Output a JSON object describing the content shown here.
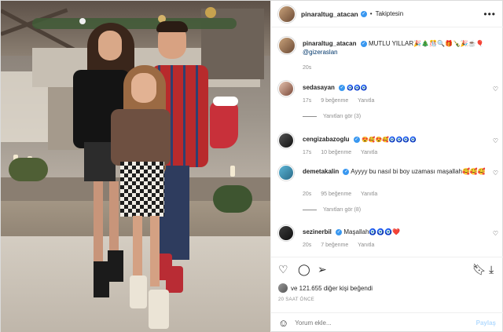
{
  "header": {
    "username": "pinaraltug_atacan",
    "follow_status": "Takiptesin",
    "more_icon": "more-horizontal-icon"
  },
  "caption": {
    "username": "pinaraltug_atacan",
    "text": "MUTLU YILLAR🎉🎄🎊🔍🎁🍾🎉☕🎈",
    "mention": "@gizeraslan",
    "time": "20s"
  },
  "comments": [
    {
      "username": "sedasayan",
      "text": "🧿🧿🧿",
      "time": "17s",
      "likes": "9 beğenme",
      "reply": "Yanıtla",
      "view_replies": "Yanıtları gör (3)"
    },
    {
      "username": "cengizabazoglu",
      "text": "😍🥰😍🥰🧿🧿🧿🧿",
      "time": "17s",
      "likes": "10 beğenme",
      "reply": "Yanıtla"
    },
    {
      "username": "demetakalin",
      "text": "Ayyyy bu nasıl bi boy uzaması maşallah🥰🥰🥰",
      "time": "20s",
      "likes": "95 beğenme",
      "reply": "Yanıtla",
      "view_replies": "Yanıtları gör (8)"
    },
    {
      "username": "sezinerbil",
      "text": "Maşallah🧿🧿🧿❤️",
      "time": "20s",
      "likes": "7 beğenme",
      "reply": "Yanıtla"
    }
  ],
  "likes": {
    "text": "ve 121.655 diğer kişi beğendi"
  },
  "time_ago": "20 SAAT ÖNCE",
  "comment_box": {
    "placeholder": "Yorum ekle...",
    "post_label": "Paylaş"
  },
  "colors": {
    "verified": "#3897f0",
    "mention": "#00376b",
    "muted": "#8e8e8e",
    "post_button": "#b3dbff"
  }
}
